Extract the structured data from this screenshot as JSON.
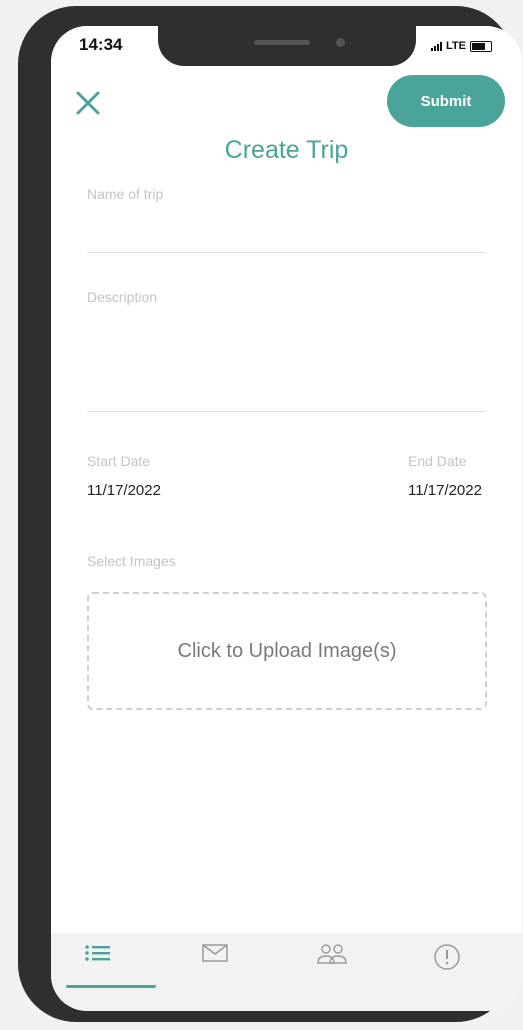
{
  "status_bar": {
    "time": "14:34",
    "network": "LTE"
  },
  "header": {
    "close_icon": "close-icon",
    "submit_label": "Submit",
    "title": "Create Trip"
  },
  "form": {
    "name_label": "Name of trip",
    "name_value": "",
    "description_label": "Description",
    "description_value": "",
    "start_date_label": "Start Date",
    "start_date_value": "11/17/2022",
    "end_date_label": "End Date",
    "end_date_value": "11/17/2022",
    "images_label": "Select Images",
    "upload_label": "Click to Upload Image(s)"
  },
  "tabbar": {
    "items": [
      {
        "icon": "list-icon",
        "active": true
      },
      {
        "icon": "mail-icon",
        "active": false
      },
      {
        "icon": "people-icon",
        "active": false
      },
      {
        "icon": "alert-icon",
        "active": false
      }
    ]
  },
  "colors": {
    "accent": "#4aa49a",
    "phone_frame": "#2f2f2f",
    "label": "#c4c4c4"
  }
}
